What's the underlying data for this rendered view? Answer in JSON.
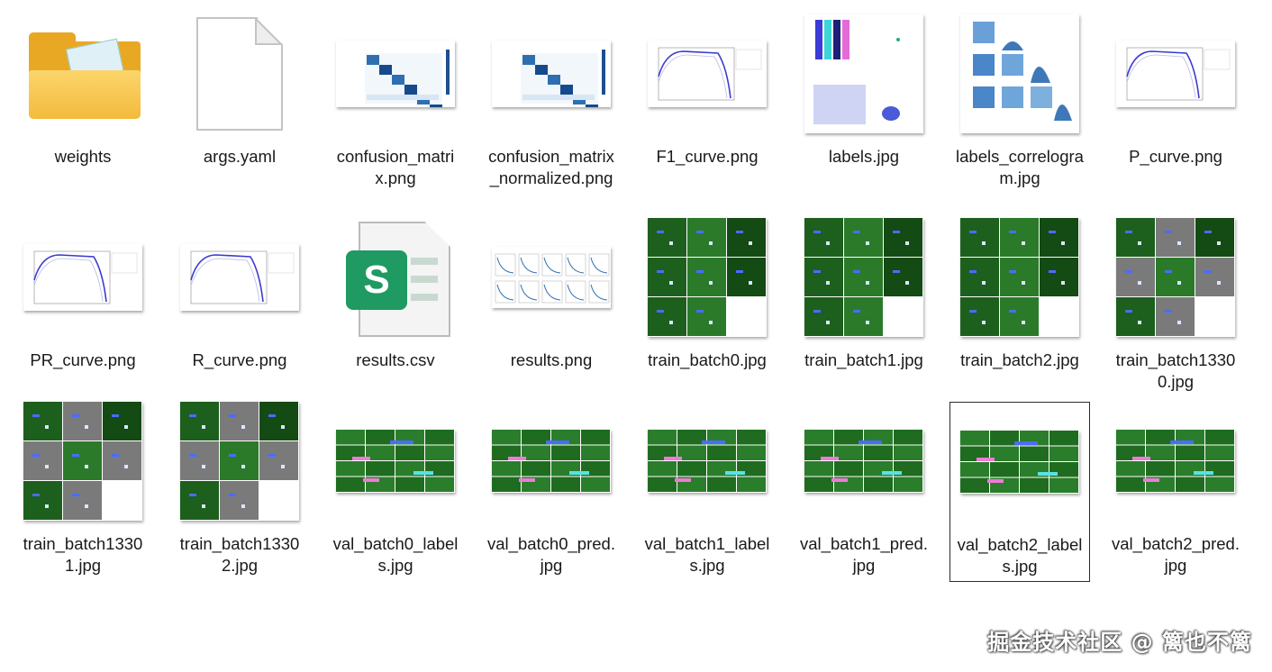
{
  "files": [
    {
      "name": "weights",
      "type": "folder"
    },
    {
      "name": "args.yaml",
      "type": "blank"
    },
    {
      "name": "confusion_matrix.png",
      "type": "matrix"
    },
    {
      "name": "confusion_matrix_normalized.png",
      "type": "matrix"
    },
    {
      "name": "F1_curve.png",
      "type": "curve"
    },
    {
      "name": "labels.jpg",
      "type": "labels"
    },
    {
      "name": "labels_correlogram.jpg",
      "type": "correlogram"
    },
    {
      "name": "P_curve.png",
      "type": "curve"
    },
    {
      "name": "PR_curve.png",
      "type": "curve"
    },
    {
      "name": "R_curve.png",
      "type": "curve"
    },
    {
      "name": "results.csv",
      "type": "csv"
    },
    {
      "name": "results.png",
      "type": "results"
    },
    {
      "name": "train_batch0.jpg",
      "type": "train"
    },
    {
      "name": "train_batch1.jpg",
      "type": "train"
    },
    {
      "name": "train_batch2.jpg",
      "type": "train"
    },
    {
      "name": "train_batch13300.jpg",
      "type": "train-gray"
    },
    {
      "name": "train_batch13301.jpg",
      "type": "train-gray"
    },
    {
      "name": "train_batch13302.jpg",
      "type": "train-gray"
    },
    {
      "name": "val_batch0_labels.jpg",
      "type": "val"
    },
    {
      "name": "val_batch0_pred.jpg",
      "type": "val"
    },
    {
      "name": "val_batch1_labels.jpg",
      "type": "val"
    },
    {
      "name": "val_batch1_pred.jpg",
      "type": "val"
    },
    {
      "name": "val_batch2_labels.jpg",
      "type": "val",
      "selected": true
    },
    {
      "name": "val_batch2_pred.jpg",
      "type": "val"
    }
  ],
  "watermark": "掘金技术社区 @ 篱也不篱",
  "colors": {
    "folder": "#f6c042",
    "green": "#1f6b1f",
    "csv": "#1e9a62"
  }
}
